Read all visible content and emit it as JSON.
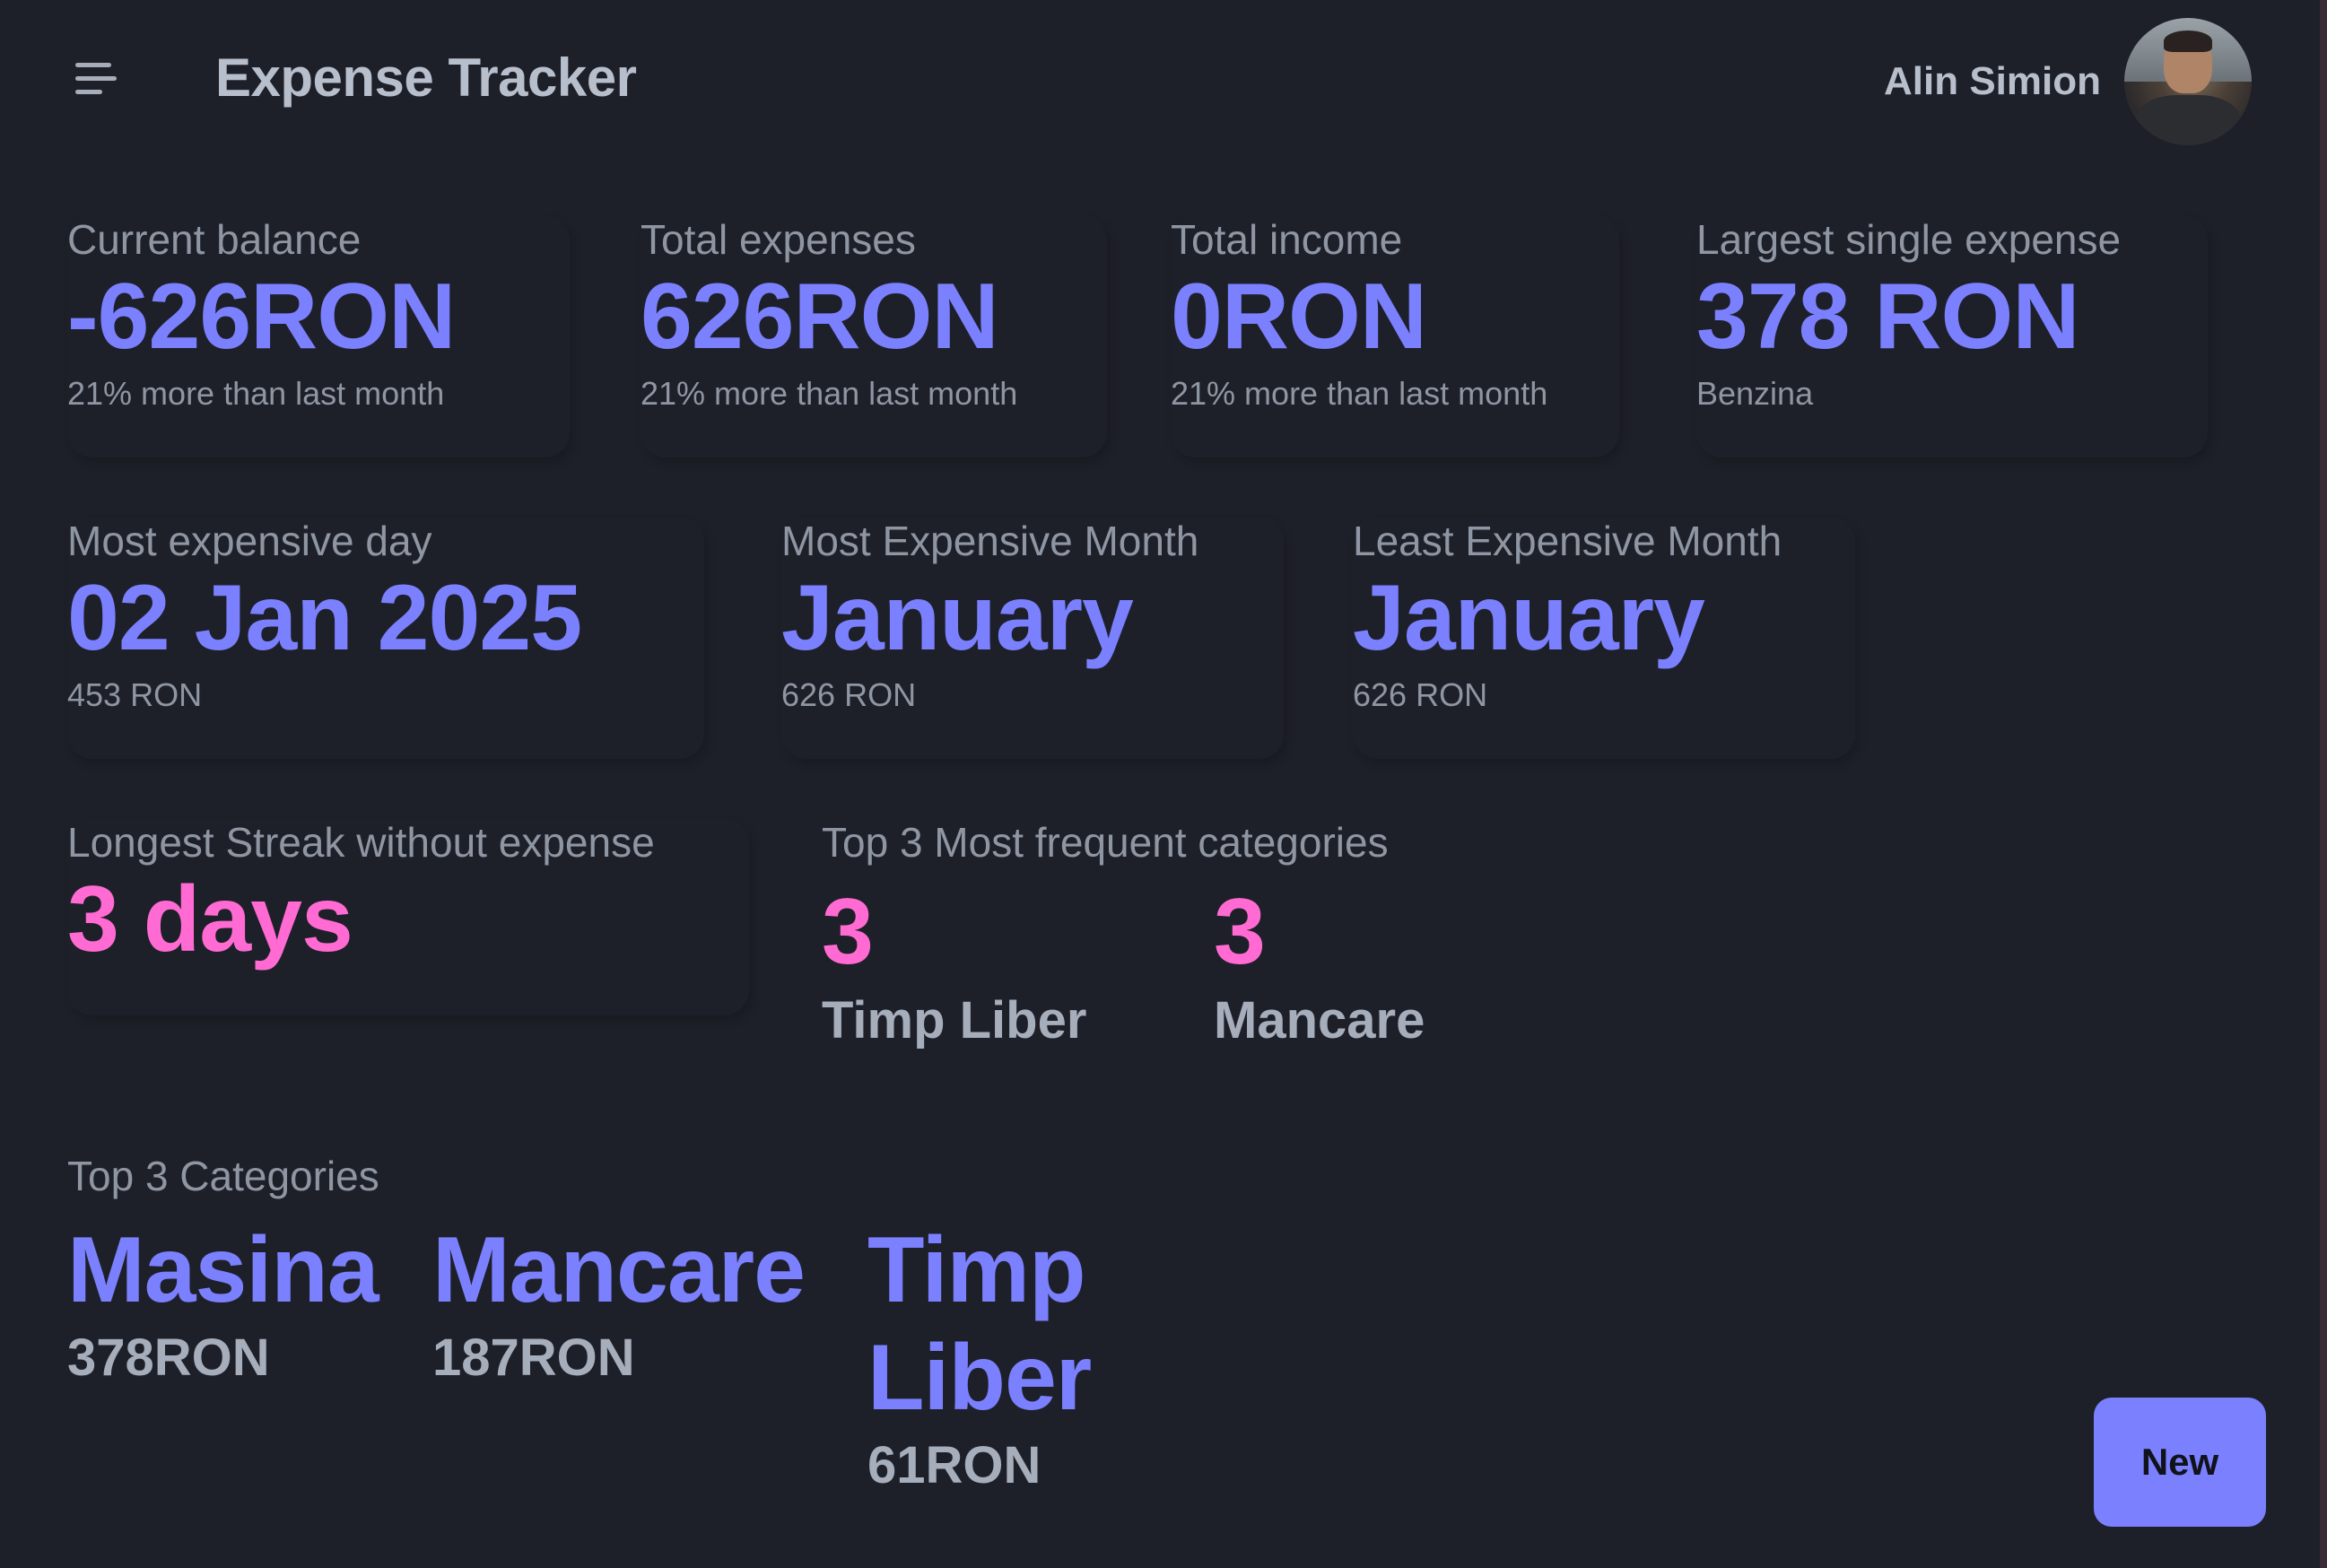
{
  "header": {
    "title": "Expense Tracker",
    "user_name": "Alin Simion"
  },
  "stats_row1": {
    "current_balance": {
      "label": "Current balance",
      "value": "-626RON",
      "desc": "21% more than last month"
    },
    "total_expenses": {
      "label": "Total expenses",
      "value": "626RON",
      "desc": "21% more than last month"
    },
    "total_income": {
      "label": "Total income",
      "value": "0RON",
      "desc": "21% more than last month"
    },
    "largest_expense": {
      "label": "Largest single expense",
      "value": "378 RON",
      "desc": "Benzina"
    }
  },
  "stats_row2": {
    "most_expensive_day": {
      "label": "Most expensive day",
      "value": "02 Jan 2025",
      "desc": "453 RON"
    },
    "most_expensive_month": {
      "label": "Most Expensive Month",
      "value": "January",
      "desc": "626 RON"
    },
    "least_expensive_month": {
      "label": "Least Expensive Month",
      "value": "January",
      "desc": "626 RON"
    }
  },
  "streak": {
    "label": "Longest Streak without expense",
    "value": "3 days"
  },
  "frequent_categories": {
    "label": "Top 3 Most frequent categories",
    "items": [
      {
        "count": "3",
        "name": "Timp Liber"
      },
      {
        "count": "3",
        "name": "Mancare"
      }
    ]
  },
  "top_categories": {
    "label": "Top 3 Categories",
    "items": [
      {
        "name": "Masina",
        "value": "378RON"
      },
      {
        "name": "Mancare",
        "value": "187RON"
      },
      {
        "name_line1": "Timp",
        "name_line2": "Liber",
        "value": "61RON"
      }
    ]
  },
  "actions": {
    "new_label": "New"
  }
}
